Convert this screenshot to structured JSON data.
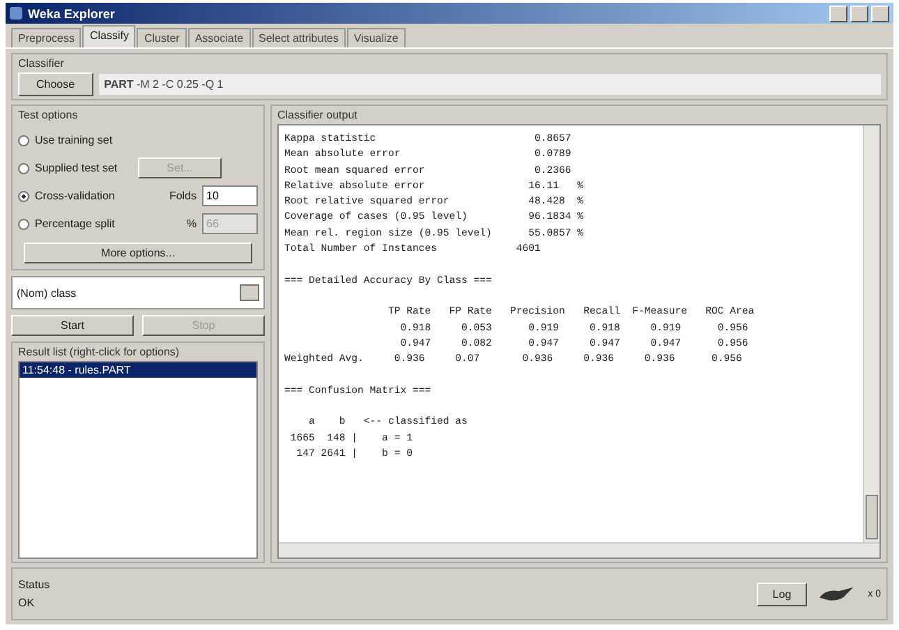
{
  "window": {
    "title": "Weka Explorer"
  },
  "tabs": [
    {
      "label": "Preprocess",
      "selected": false
    },
    {
      "label": "Classify",
      "selected": true
    },
    {
      "label": "Cluster",
      "selected": false
    },
    {
      "label": "Associate",
      "selected": false
    },
    {
      "label": "Select attributes",
      "selected": false
    },
    {
      "label": "Visualize",
      "selected": false
    }
  ],
  "classifier": {
    "title": "Classifier",
    "button": "Choose",
    "name": "PART",
    "options": "-M 2 -C 0.25 -Q 1"
  },
  "test_options": {
    "title": "Test options",
    "options": [
      {
        "label": "Use training set",
        "selected": false
      },
      {
        "label": "Supplied test set",
        "selected": false,
        "button": "Set..."
      },
      {
        "label": "Cross-validation",
        "selected": true,
        "field_label": "Folds",
        "value": "10"
      },
      {
        "label": "Percentage split",
        "selected": false,
        "field_label": "%",
        "value": "66"
      }
    ],
    "more": "More options..."
  },
  "class_select": "(Nom) class",
  "start": {
    "label": "Start",
    "disabled": false
  },
  "stop": {
    "label": "Stop",
    "disabled": true
  },
  "result_list": {
    "title": "Result list (right-click for options)",
    "items": [
      {
        "label": "11:54:48 - rules.PART",
        "selected": true
      }
    ]
  },
  "output": {
    "title": "Classifier output",
    "blocks": [
      [
        "Kappa statistic                          0.8657",
        "Mean absolute error                      0.0789",
        "Root mean squared error                  0.2366",
        "Relative absolute error                 16.11   %",
        "Root relative squared error             48.428  %",
        "Coverage of cases (0.95 level)          96.1834 %",
        "Mean rel. region size (0.95 level)      55.0857 %",
        "Total Number of Instances             4601"
      ],
      [
        "=== Detailed Accuracy By Class ==="
      ],
      [
        "                 TP Rate   FP Rate   Precision   Recall  F-Measure   ROC Area",
        "                   0.918     0.053      0.919     0.918     0.919      0.956",
        "                   0.947     0.082      0.947     0.947     0.947      0.956",
        "Weighted Avg.     0.936     0.07       0.936     0.936     0.936      0.956"
      ],
      [
        "=== Confusion Matrix ==="
      ],
      [
        "    a    b   <-- classified as",
        " 1665  148 |    a = 1",
        "  147 2641 |    b = 0"
      ]
    ]
  },
  "status": {
    "title": "Status",
    "text": "OK",
    "log": "Log",
    "count": "x 0"
  }
}
